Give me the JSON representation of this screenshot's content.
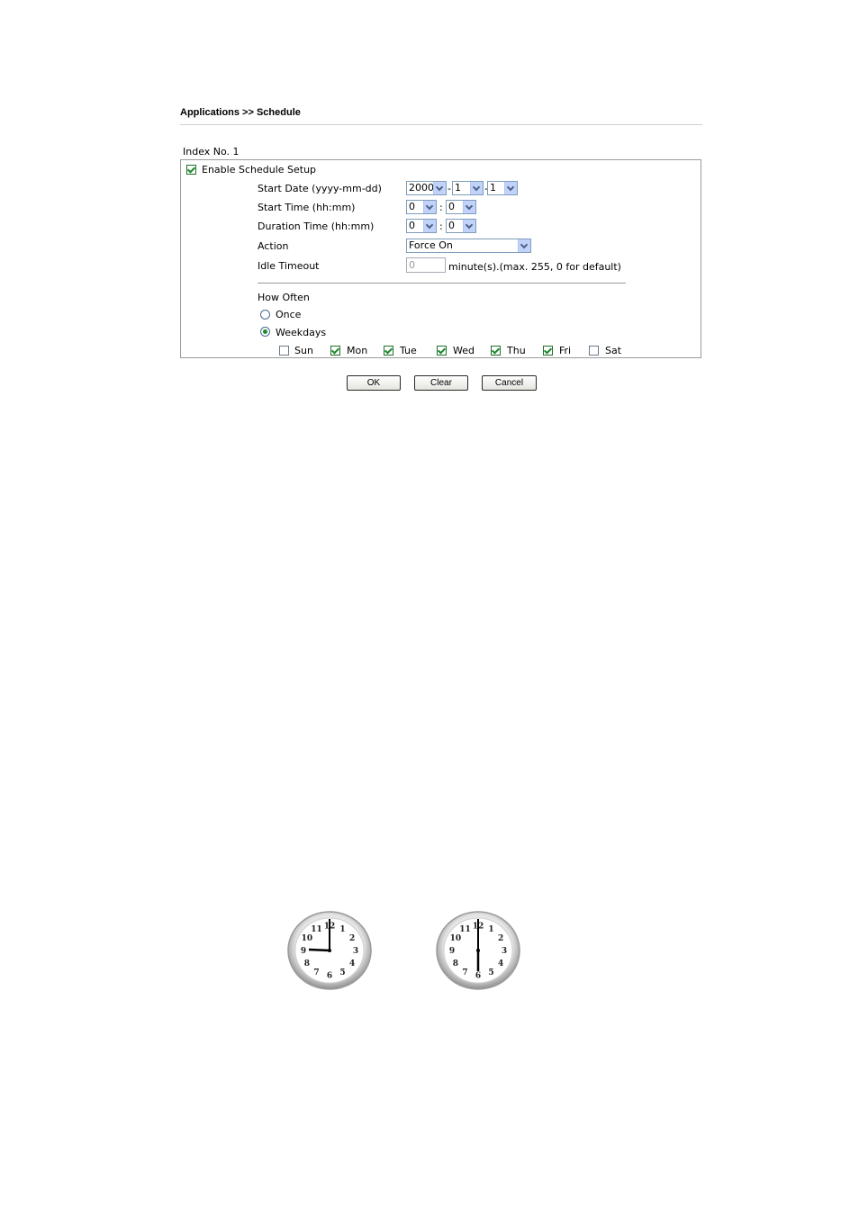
{
  "breadcrumb": "Applications >> Schedule",
  "index_label": "Index No. 1",
  "enable": {
    "label": "Enable Schedule Setup",
    "checked": true
  },
  "fields": {
    "start_date": {
      "label": "Start Date (yyyy-mm-dd)",
      "year": "2000",
      "month": "1",
      "day": "1"
    },
    "start_time": {
      "label": "Start Time (hh:mm)",
      "hour": "0",
      "minute": "0"
    },
    "duration": {
      "label": "Duration Time (hh:mm)",
      "hour": "0",
      "minute": "0"
    },
    "action": {
      "label": "Action",
      "value": "Force On"
    },
    "idle_timeout": {
      "label": "Idle Timeout",
      "value": "0",
      "hint": "minute(s).(max. 255, 0 for default)"
    }
  },
  "separators": {
    "dash": "-",
    "colon": ":"
  },
  "how_often": {
    "label": "How Often",
    "once": {
      "label": "Once",
      "selected": false
    },
    "weekdays": {
      "label": "Weekdays",
      "selected": true
    },
    "days": [
      {
        "label": "Sun",
        "checked": false
      },
      {
        "label": "Mon",
        "checked": true
      },
      {
        "label": "Tue",
        "checked": true
      },
      {
        "label": "Wed",
        "checked": true
      },
      {
        "label": "Thu",
        "checked": true
      },
      {
        "label": "Fri",
        "checked": true
      },
      {
        "label": "Sat",
        "checked": false
      }
    ]
  },
  "buttons": {
    "ok": "OK",
    "clear": "Clear",
    "cancel": "Cancel"
  },
  "clocks": [
    {
      "hour_hand_points_to": 9,
      "minute_hand_points_to": 12,
      "dial_numbers": [
        "12",
        "1",
        "2",
        "3",
        "4",
        "5",
        "6",
        "7",
        "8",
        "9",
        "10",
        "11"
      ]
    },
    {
      "hour_hand_points_to": 6,
      "minute_hand_points_to": 12,
      "dial_numbers": [
        "12",
        "1",
        "2",
        "3",
        "4",
        "5",
        "6",
        "7",
        "8",
        "9",
        "10",
        "11"
      ]
    }
  ],
  "colors": {
    "check": "#1b8a2a",
    "select_arrow": "#c1d3fb",
    "panel_border": "#9a9a9a"
  }
}
